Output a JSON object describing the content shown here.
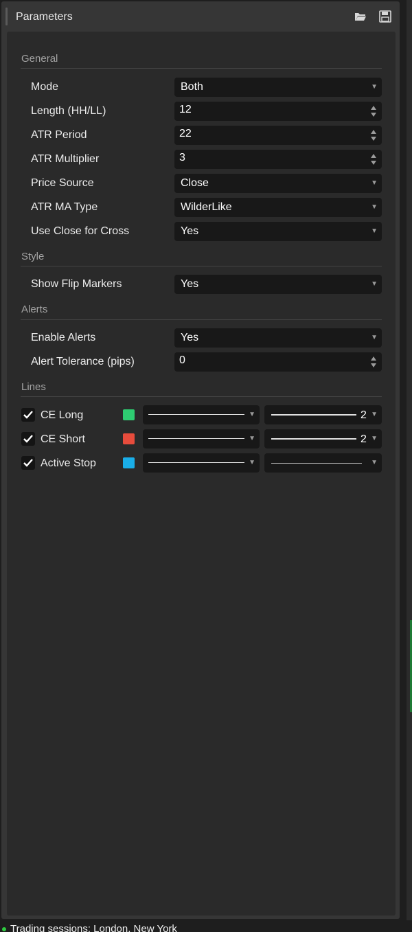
{
  "header": {
    "title": "Parameters",
    "icons": [
      "open-folder-icon",
      "save-icon"
    ]
  },
  "sections": {
    "general": {
      "title": "General",
      "rows": [
        {
          "label": "Mode",
          "value": "Both",
          "kind": "select"
        },
        {
          "label": "Length (HH/LL)",
          "value": "12",
          "kind": "number"
        },
        {
          "label": "ATR Period",
          "value": "22",
          "kind": "number"
        },
        {
          "label": "ATR Multiplier",
          "value": "3",
          "kind": "number"
        },
        {
          "label": "Price Source",
          "value": "Close",
          "kind": "select"
        },
        {
          "label": "ATR MA Type",
          "value": "WilderLike",
          "kind": "select"
        },
        {
          "label": "Use Close for Cross",
          "value": "Yes",
          "kind": "select"
        }
      ]
    },
    "style": {
      "title": "Style",
      "rows": [
        {
          "label": "Show Flip Markers",
          "value": "Yes",
          "kind": "select"
        }
      ]
    },
    "alerts": {
      "title": "Alerts",
      "rows": [
        {
          "label": "Enable Alerts",
          "value": "Yes",
          "kind": "select"
        },
        {
          "label": "Alert Tolerance (pips)",
          "value": "0",
          "kind": "number"
        }
      ]
    },
    "lines": {
      "title": "Lines",
      "rows": [
        {
          "label": "CE Long",
          "checked": true,
          "color": "#2ecc71",
          "line_style": "solid",
          "width": "2"
        },
        {
          "label": "CE Short",
          "checked": true,
          "color": "#e74c3c",
          "line_style": "solid",
          "width": "2"
        },
        {
          "label": "Active Stop",
          "checked": true,
          "color": "#1aaee8",
          "line_style": "solid",
          "width": ""
        }
      ]
    }
  },
  "status": {
    "text": "Trading sessions: London, New York",
    "dot_color": "#2ecc40"
  },
  "colors": {
    "panel": "#363636",
    "content": "#2a2a2a",
    "field": "#181818",
    "section_text": "#a3a3a3"
  }
}
